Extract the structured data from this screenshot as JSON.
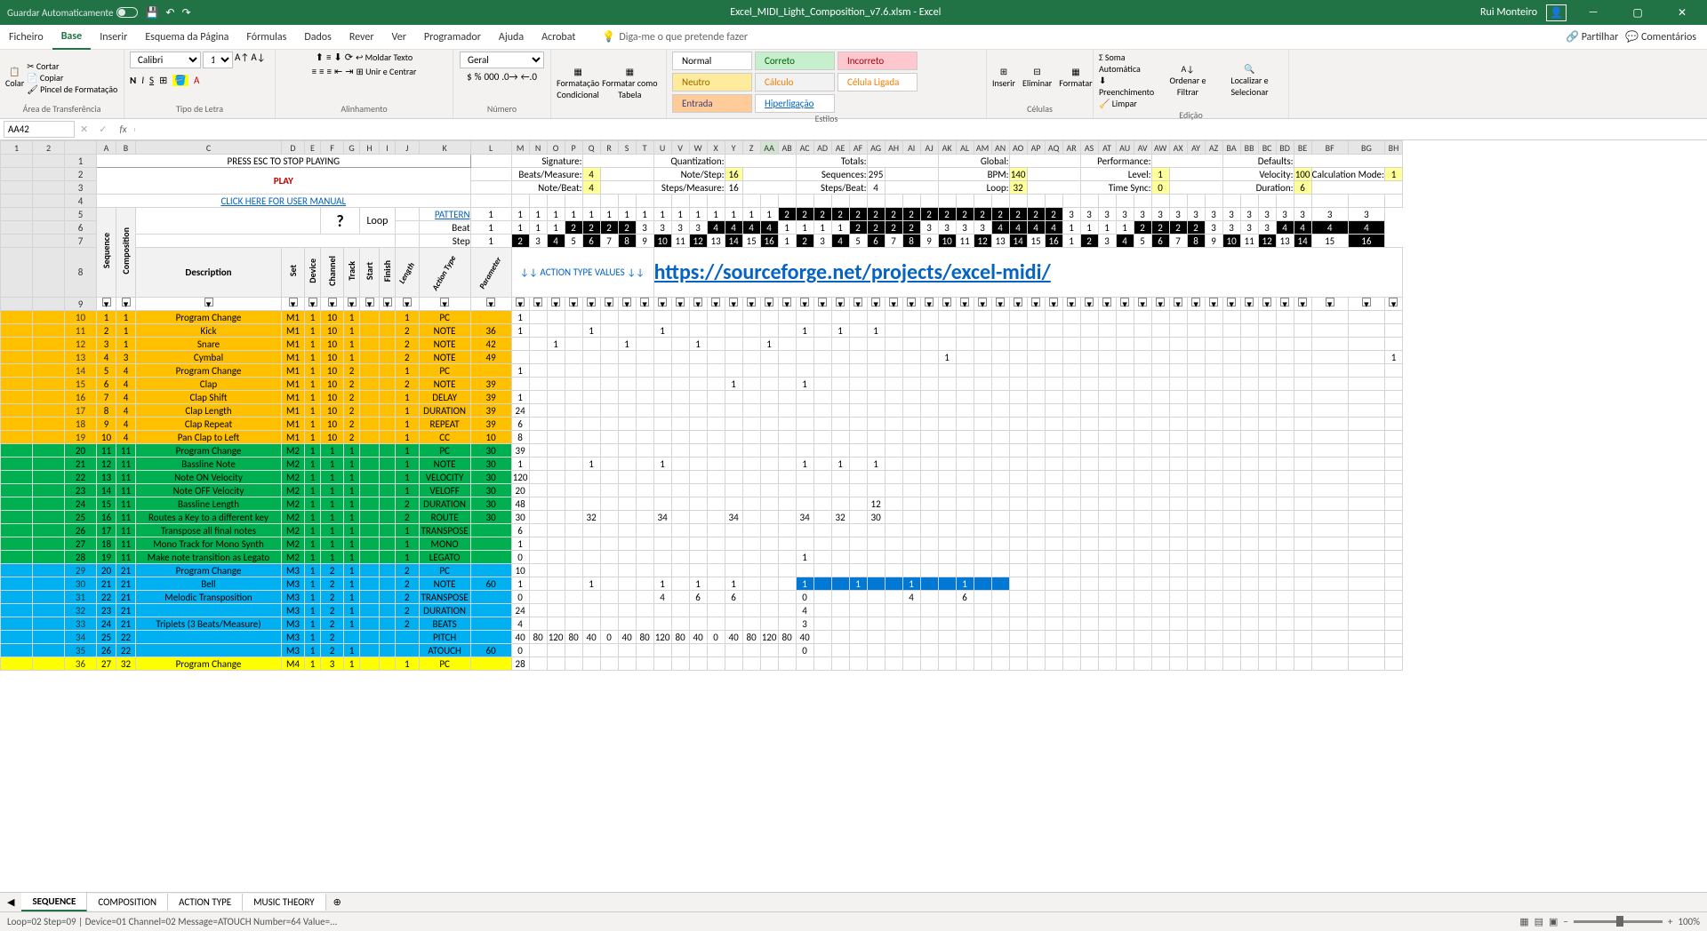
{
  "title": "Excel_MIDI_Light_Composition_v7.6.xlsm - Excel",
  "user": "Rui Monteiro",
  "autosave": "Guardar Automaticamente",
  "menu": {
    "ficheiro": "Ficheiro",
    "base": "Base",
    "inserir": "Inserir",
    "esquema": "Esquema da Página",
    "formulas": "Fórmulas",
    "dados": "Dados",
    "rever": "Rever",
    "ver": "Ver",
    "programador": "Programador",
    "ajuda": "Ajuda",
    "acrobat": "Acrobat",
    "search": "Diga-me o que pretende fazer",
    "partilhar": "Partilhar",
    "comentarios": "Comentários"
  },
  "ribbon": {
    "clipboard": {
      "label": "Área de Transferência",
      "cortar": "Cortar",
      "copiar": "Copiar",
      "colar": "Colar",
      "pincel": "Pincel de Formatação"
    },
    "font": {
      "label": "Tipo de Letra",
      "name": "Calibri",
      "size": "11"
    },
    "align": {
      "label": "Alinhamento",
      "moldar": "Moldar Texto",
      "unir": "Unir e Centrar"
    },
    "number": {
      "label": "Número",
      "format": "Geral"
    },
    "condfmt": {
      "label1": "Formatação",
      "label2": "Condicional"
    },
    "table": {
      "label1": "Formatar como",
      "label2": "Tabela"
    },
    "styles": {
      "label": "Estilos",
      "normal": "Normal",
      "correto": "Correto",
      "incorreto": "Incorreto",
      "neutro": "Neutro",
      "calculo": "Cálculo",
      "ligada": "Célula Ligada",
      "entrada": "Entrada",
      "hiper": "Hiperligação"
    },
    "cells": {
      "label": "Células",
      "inserir": "Inserir",
      "eliminar": "Eliminar",
      "formatar": "Formatar"
    },
    "editing": {
      "label": "Edição",
      "soma": "Soma Automática",
      "preench": "Preenchimento",
      "limpar": "Limpar",
      "ordenar": "Ordenar e Filtrar",
      "localizar": "Localizar e Selecionar"
    }
  },
  "namebox": "AA42",
  "sheet_tabs": [
    "SEQUENCE",
    "COMPOSITION",
    "ACTION TYPE",
    "MUSIC THEORY"
  ],
  "statusbar": "Loop=02 Step=09 | Device=01 Channel=02 Message=ATOUCH Number=64 Value=...",
  "zoom": "100%",
  "headers_top": {
    "esc": "PRESS ESC TO STOP PLAYING",
    "play": "PLAY",
    "manual": "CLICK HERE FOR USER MANUAL",
    "pattern": "PATTERN",
    "beat": "Beat",
    "step": "Step",
    "loop": "Loop",
    "q": "?",
    "action_values": "↓↓ ACTION TYPE VALUES ↓↓",
    "sf_link": "https://sourceforge.net/projects/excel-midi/"
  },
  "params": {
    "signature": "Signature:",
    "beats_measure": "Beats/Measure:",
    "bm_v": "4",
    "note_beat": "Note/Beat:",
    "nb_v": "4",
    "quantization": "Quantization:",
    "note_step": "Note/Step:",
    "ns_v": "16",
    "steps_measure": "Steps/Measure:",
    "sm_v": "16",
    "totals": "Totals:",
    "sequences": "Sequences:",
    "seq_v": "295",
    "steps_beat": "Steps/Beat:",
    "sb_v": "4",
    "global": "Global:",
    "bpm": "BPM:",
    "bpm_v": "140",
    "loop": "Loop:",
    "loop_v": "32",
    "performance": "Performance:",
    "level": "Level:",
    "lvl_v": "1",
    "time_sync": "Time Sync:",
    "ts_v": "0",
    "defaults": "Defaults:",
    "velocity": "Velocity:",
    "vel_v": "100",
    "duration": "Duration:",
    "dur_v": "6",
    "calc_mode": "Calculation Mode:",
    "cm_v": "1"
  },
  "col_hdrs": {
    "seq": "Sequence",
    "comp": "Composition",
    "desc": "Description",
    "set": "Set",
    "device": "Device",
    "channel": "Channel",
    "track": "Track",
    "start": "Start",
    "finish": "Finish",
    "length": "Length",
    "action": "Action Type",
    "param": "Parameter"
  },
  "rows": [
    {
      "rn": 10,
      "a": 1,
      "b": 1,
      "desc": "Program Change",
      "set": "M1",
      "dev": 1,
      "ch": 10,
      "trk": 1,
      "st": "",
      "fin": "",
      "len": 1,
      "act": "PC",
      "par": "",
      "L": 1,
      "cls": "orange-row",
      "steps": {
        "0": 1
      }
    },
    {
      "rn": 11,
      "a": 2,
      "b": 1,
      "desc": "Kick",
      "set": "M1",
      "dev": 1,
      "ch": 10,
      "trk": 1,
      "st": "",
      "fin": "",
      "len": 2,
      "act": "NOTE",
      "par": 36,
      "L": 1,
      "cls": "orange-row",
      "steps": {
        "0": 1,
        "4": 1,
        "8": 1,
        "16": 1,
        "18": 1,
        "20": 1
      }
    },
    {
      "rn": 12,
      "a": 3,
      "b": 1,
      "desc": "Snare",
      "set": "M1",
      "dev": 1,
      "ch": 10,
      "trk": 1,
      "st": "",
      "fin": "",
      "len": 2,
      "act": "NOTE",
      "par": 42,
      "L": "",
      "cls": "orange-row",
      "steps": {
        "2": 1,
        "6": 1,
        "10": 1,
        "14": 1
      }
    },
    {
      "rn": 13,
      "a": 4,
      "b": 3,
      "desc": "Cymbal",
      "set": "M1",
      "dev": 1,
      "ch": 10,
      "trk": 1,
      "st": "",
      "fin": "",
      "len": 2,
      "act": "NOTE",
      "par": 49,
      "L": "",
      "cls": "orange-row",
      "steps": {
        "24": 1,
        "47": 1
      }
    },
    {
      "rn": 14,
      "a": 5,
      "b": 4,
      "desc": "Program Change",
      "set": "M1",
      "dev": 1,
      "ch": 10,
      "trk": 2,
      "st": "",
      "fin": "",
      "len": 1,
      "act": "PC",
      "par": "",
      "L": 1,
      "cls": "orange-row",
      "steps": {
        "0": 1
      }
    },
    {
      "rn": 15,
      "a": 6,
      "b": 4,
      "desc": "Clap",
      "set": "M1",
      "dev": 1,
      "ch": 10,
      "trk": 2,
      "st": "",
      "fin": "",
      "len": 2,
      "act": "NOTE",
      "par": 39,
      "L": "",
      "cls": "orange-row",
      "steps": {
        "12": 1,
        "16": 1
      }
    },
    {
      "rn": 16,
      "a": 7,
      "b": 4,
      "desc": "Clap Shift",
      "set": "M1",
      "dev": 1,
      "ch": 10,
      "trk": 2,
      "st": "",
      "fin": "",
      "len": 1,
      "act": "DELAY",
      "par": 39,
      "L": 1,
      "cls": "orange-row",
      "steps": {
        "0": 1
      }
    },
    {
      "rn": 17,
      "a": 8,
      "b": 4,
      "desc": "Clap Length",
      "set": "M1",
      "dev": 1,
      "ch": 10,
      "trk": 2,
      "st": "",
      "fin": "",
      "len": 1,
      "act": "DURATION",
      "par": 39,
      "L": 24,
      "cls": "orange-row",
      "steps": {}
    },
    {
      "rn": 18,
      "a": 9,
      "b": 4,
      "desc": "Clap Repeat",
      "set": "M1",
      "dev": 1,
      "ch": 10,
      "trk": 2,
      "st": "",
      "fin": "",
      "len": 1,
      "act": "REPEAT",
      "par": 39,
      "L": 6,
      "cls": "orange-row",
      "steps": {}
    },
    {
      "rn": 19,
      "a": 10,
      "b": 4,
      "desc": "Pan Clap to Left",
      "set": "M1",
      "dev": 1,
      "ch": 10,
      "trk": 2,
      "st": "",
      "fin": "",
      "len": 1,
      "act": "CC",
      "par": 10,
      "L": 8,
      "cls": "orange-row",
      "steps": {}
    },
    {
      "rn": 20,
      "a": 11,
      "b": 11,
      "desc": "Program Change",
      "set": "M2",
      "dev": 1,
      "ch": 1,
      "trk": 1,
      "st": "",
      "fin": "",
      "len": 1,
      "act": "PC",
      "par": 30,
      "L": 39,
      "cls": "green-row",
      "steps": {}
    },
    {
      "rn": 21,
      "a": 12,
      "b": 11,
      "desc": "Bassline Note",
      "set": "M2",
      "dev": 1,
      "ch": 1,
      "trk": 1,
      "st": "",
      "fin": "",
      "len": 1,
      "act": "NOTE",
      "par": 30,
      "L": 1,
      "cls": "green-row",
      "steps": {
        "4": 1,
        "8": 1,
        "16": 1,
        "18": 1,
        "20": 1
      }
    },
    {
      "rn": 22,
      "a": 13,
      "b": 11,
      "desc": "Note ON Velocity",
      "set": "M2",
      "dev": 1,
      "ch": 1,
      "trk": 1,
      "st": "",
      "fin": "",
      "len": 1,
      "act": "VELOCITY",
      "par": 30,
      "L": 120,
      "cls": "green-row",
      "steps": {}
    },
    {
      "rn": 23,
      "a": 14,
      "b": 11,
      "desc": "Note OFF Velocity",
      "set": "M2",
      "dev": 1,
      "ch": 1,
      "trk": 1,
      "st": "",
      "fin": "",
      "len": 1,
      "act": "VELOFF",
      "par": 30,
      "L": 20,
      "cls": "green-row",
      "steps": {}
    },
    {
      "rn": 24,
      "a": 15,
      "b": 11,
      "desc": "Bassline Length",
      "set": "M2",
      "dev": 1,
      "ch": 1,
      "trk": 1,
      "st": "",
      "fin": "",
      "len": 2,
      "act": "DURATION",
      "par": 30,
      "L": 48,
      "cls": "green-row",
      "steps": {
        "20": 12
      }
    },
    {
      "rn": 25,
      "a": 16,
      "b": 11,
      "desc": "Routes a Key to a different key",
      "set": "M2",
      "dev": 1,
      "ch": 1,
      "trk": 1,
      "st": "",
      "fin": "",
      "len": 2,
      "act": "ROUTE",
      "par": 30,
      "L": 30,
      "cls": "green-row",
      "steps": {
        "4": 32,
        "8": 34,
        "12": 34,
        "16": 34,
        "18": 32,
        "20": 30
      }
    },
    {
      "rn": 26,
      "a": 17,
      "b": 11,
      "desc": "Transpose all final notes",
      "set": "M2",
      "dev": 1,
      "ch": 1,
      "trk": 1,
      "st": "",
      "fin": "",
      "len": 1,
      "act": "TRANSPOSE",
      "par": "",
      "L": 6,
      "cls": "green-row",
      "steps": {}
    },
    {
      "rn": 27,
      "a": 18,
      "b": 11,
      "desc": "Mono Track for Mono Synth",
      "set": "M2",
      "dev": 1,
      "ch": 1,
      "trk": 1,
      "st": "",
      "fin": "",
      "len": 1,
      "act": "MONO",
      "par": "",
      "L": 1,
      "cls": "green-row",
      "steps": {}
    },
    {
      "rn": 28,
      "a": 19,
      "b": 11,
      "desc": "Make note transition as Legato",
      "set": "M2",
      "dev": 1,
      "ch": 1,
      "trk": 1,
      "st": "",
      "fin": "",
      "len": 1,
      "act": "LEGATO",
      "par": "",
      "L": 0,
      "cls": "green-row",
      "steps": {
        "16": 1
      }
    },
    {
      "rn": 29,
      "a": 20,
      "b": 21,
      "desc": "Program Change",
      "set": "M3",
      "dev": 1,
      "ch": 2,
      "trk": 1,
      "st": "",
      "fin": "",
      "len": 2,
      "act": "PC",
      "par": "",
      "L": 10,
      "cls": "blue-row",
      "steps": {}
    },
    {
      "rn": 30,
      "a": 21,
      "b": 21,
      "desc": "Bell",
      "set": "M3",
      "dev": 1,
      "ch": 2,
      "trk": 1,
      "st": "",
      "fin": "",
      "len": 2,
      "act": "NOTE",
      "par": 60,
      "L": 1,
      "cls": "blue-row",
      "steps": {
        "4": 1,
        "8": 1,
        "10": 1,
        "12": 1
      },
      "sel": [
        16,
        17,
        18,
        19,
        20,
        21,
        22,
        23,
        24,
        25,
        26,
        27
      ],
      "selv": {
        "16": 1,
        "19": 1,
        "22": 1,
        "25": 1
      }
    },
    {
      "rn": 31,
      "a": 22,
      "b": 21,
      "desc": "Melodic Transposition",
      "set": "M3",
      "dev": 1,
      "ch": 2,
      "trk": 1,
      "st": "",
      "fin": "",
      "len": 2,
      "act": "TRANSPOSE",
      "par": "",
      "L": 0,
      "cls": "blue-row",
      "steps": {
        "8": 4,
        "10": 6,
        "12": 6,
        "16": 0,
        "22": 4,
        "25": 6
      }
    },
    {
      "rn": 32,
      "a": 23,
      "b": 21,
      "desc": "",
      "set": "M3",
      "dev": 1,
      "ch": 2,
      "trk": 1,
      "st": "",
      "fin": "",
      "len": 2,
      "act": "DURATION",
      "par": "",
      "L": 24,
      "cls": "blue-row",
      "steps": {
        "16": 4
      }
    },
    {
      "rn": 33,
      "a": 24,
      "b": 21,
      "desc": "Triplets (3 Beats/Measure)",
      "set": "M3",
      "dev": 1,
      "ch": 2,
      "trk": 1,
      "st": "",
      "fin": "",
      "len": 2,
      "act": "BEATS",
      "par": "",
      "L": 4,
      "cls": "blue-row",
      "steps": {
        "16": 3
      }
    },
    {
      "rn": 34,
      "a": 25,
      "b": 22,
      "desc": "",
      "set": "M3",
      "dev": 1,
      "ch": 2,
      "trk": "",
      "st": "",
      "fin": "",
      "len": "",
      "act": "PITCH",
      "par": "",
      "L": 40,
      "cls": "blue-row",
      "steps": {
        "1": 80,
        "2": 120,
        "3": 80,
        "4": 40,
        "5": 0,
        "6": 40,
        "7": 80,
        "8": 120,
        "9": 80,
        "10": 40,
        "11": 0,
        "12": 40,
        "13": 80,
        "14": 120,
        "15": 80,
        "16": 40
      }
    },
    {
      "rn": 35,
      "a": 26,
      "b": 22,
      "desc": "",
      "set": "M3",
      "dev": 1,
      "ch": 2,
      "trk": 1,
      "st": "",
      "fin": "",
      "len": "",
      "act": "ATOUCH",
      "par": 60,
      "L": 0,
      "cls": "blue-row",
      "steps": {
        "16": 0
      }
    },
    {
      "rn": 36,
      "a": 27,
      "b": 32,
      "desc": "Program Change",
      "set": "M4",
      "dev": 1,
      "ch": 3,
      "trk": 1,
      "st": "",
      "fin": "",
      "len": 1,
      "act": "PC",
      "par": "",
      "L": 28,
      "cls": "yellow-row",
      "steps": {}
    }
  ],
  "pattern_row": [
    1,
    1,
    1,
    1,
    1,
    1,
    1,
    1,
    1,
    1,
    1,
    1,
    1,
    1,
    1,
    1,
    2,
    2,
    2,
    2,
    2,
    2,
    2,
    2,
    2,
    2,
    2,
    2,
    2,
    2,
    2,
    2,
    3,
    3,
    3,
    3,
    3,
    3,
    3,
    3,
    3,
    3,
    3,
    3,
    3,
    3,
    3,
    3
  ],
  "beat_row": [
    1,
    1,
    1,
    1,
    2,
    2,
    2,
    2,
    3,
    3,
    3,
    3,
    4,
    4,
    4,
    4,
    1,
    1,
    1,
    1,
    2,
    2,
    2,
    2,
    3,
    3,
    3,
    3,
    4,
    4,
    4,
    4,
    1,
    1,
    1,
    1,
    2,
    2,
    2,
    2,
    3,
    3,
    3,
    3,
    4,
    4,
    4,
    4
  ],
  "step_row": [
    1,
    2,
    3,
    4,
    5,
    6,
    7,
    8,
    9,
    10,
    11,
    12,
    13,
    14,
    15,
    16,
    1,
    2,
    3,
    4,
    5,
    6,
    7,
    8,
    9,
    10,
    11,
    12,
    13,
    14,
    15,
    16,
    1,
    2,
    3,
    4,
    5,
    6,
    7,
    8,
    9,
    10,
    11,
    12,
    13,
    14,
    15,
    16
  ],
  "colletters": [
    "A",
    "B",
    "C",
    "D",
    "E",
    "F",
    "G",
    "H",
    "I",
    "J",
    "K",
    "L",
    "M",
    "N",
    "O",
    "P",
    "Q",
    "R",
    "S",
    "T",
    "U",
    "V",
    "W",
    "X",
    "Y",
    "Z",
    "AA",
    "AB",
    "AC",
    "AD",
    "AE",
    "AF",
    "AG",
    "AH",
    "AI",
    "AJ",
    "AK",
    "AL",
    "AM",
    "AN",
    "AO",
    "AP",
    "AQ",
    "AR",
    "AS",
    "AT",
    "AU",
    "AV",
    "AW",
    "AX",
    "AY",
    "AZ",
    "BA",
    "BB",
    "BC",
    "BD",
    "BE",
    "BF",
    "BG",
    "BH"
  ]
}
